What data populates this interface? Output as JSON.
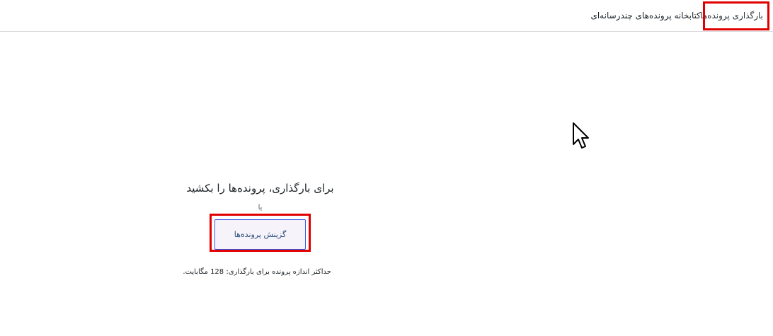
{
  "tabs": {
    "upload_label": "بارگذاری پرونده‌ها",
    "library_label": "کتابخانه پرونده‌های چندرسانه‌ای"
  },
  "uploader": {
    "drop_title": "برای بارگذاری، پرونده‌ها را بکشید",
    "or_text": "یا",
    "select_button_label": "گزینش پرونده‌ها",
    "max_size_text": "حداکثر اندازه پرونده برای بارگذاری: 128 مگابایت."
  },
  "colors": {
    "highlight": "#e00000",
    "button_border": "#3858e9",
    "button_bg": "#f6f3fa"
  },
  "icons": {
    "cursor": "mouse-pointer-icon"
  }
}
